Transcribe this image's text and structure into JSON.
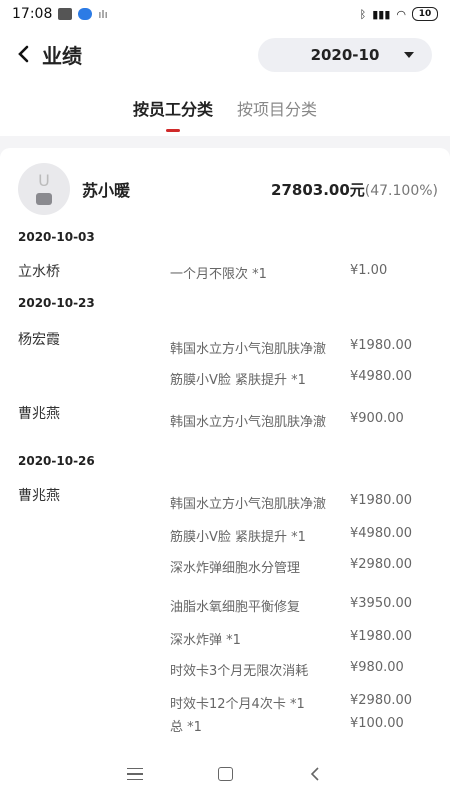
{
  "status": {
    "time": "17:08",
    "battery": "10"
  },
  "header": {
    "back_label": "<",
    "title": "业绩",
    "month": "2020-10"
  },
  "tabs": [
    {
      "label": "按员工分类"
    },
    {
      "label": "按项目分类"
    }
  ],
  "employee": {
    "avatar_letter": "U",
    "name": "苏小暖",
    "amount": "27803.00元",
    "pct": "(47.100%)"
  },
  "dates": [
    "2020-10-03",
    "2020-10-23",
    "2020-10-26"
  ],
  "customers": [
    "立水桥",
    "杨宏霞",
    "曹兆燕",
    "曹兆燕"
  ],
  "records": [
    {
      "item": "一个月不限次 *1",
      "price": "¥1.00"
    },
    {
      "item": "韩国水立方小气泡肌肤净澈",
      "price": "¥1980.00"
    },
    {
      "item": "筋膜小V脸 紧肤提升 *1",
      "price": "¥4980.00"
    },
    {
      "item": "韩国水立方小气泡肌肤净澈",
      "price": "¥900.00"
    },
    {
      "item": "韩国水立方小气泡肌肤净澈",
      "price": "¥1980.00"
    },
    {
      "item": "筋膜小V脸 紧肤提升 *1",
      "price": "¥4980.00"
    },
    {
      "item": "深水炸弹细胞水分管理",
      "price": "¥2980.00"
    },
    {
      "item": "油脂水氧细胞平衡修复",
      "price": "¥3950.00"
    },
    {
      "item": "深水炸弹 *1",
      "price": "¥1980.00"
    },
    {
      "item": "时效卡3个月无限次消耗",
      "price": "¥980.00"
    },
    {
      "item": "时效卡12个月4次卡 *1",
      "price": "¥2980.00"
    },
    {
      "item": "总 *1",
      "price": "¥100.00"
    }
  ],
  "icons": {
    "back": "chevron-left-icon",
    "caret": "caret-down-icon",
    "menu": "menu-icon",
    "home": "home-icon",
    "nav_back": "nav-back-icon"
  },
  "colors": {
    "accent": "#d02a2a"
  }
}
